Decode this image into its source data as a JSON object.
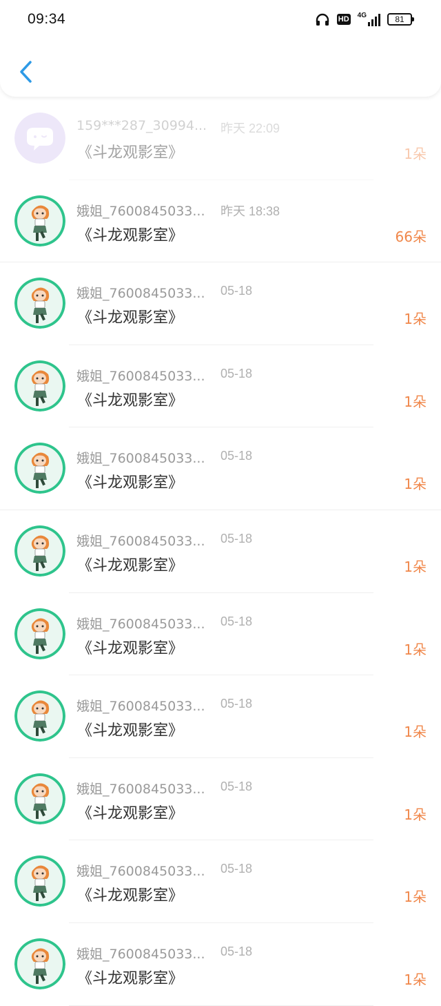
{
  "status_bar": {
    "time": "09:34",
    "icons": [
      "headphones-icon",
      "hd-icon",
      "cellular-4g-icon",
      "battery-icon"
    ],
    "hd_label": "HD",
    "network_label": "4G",
    "battery_level": "81"
  },
  "header": {
    "back_icon": "chevron-left-icon",
    "accent_color": "#2e9ae6"
  },
  "colors": {
    "flower_count": "#f0874a",
    "username": "#9a9a9a",
    "time": "#b0b0b0",
    "title": "#333333"
  },
  "records": [
    {
      "user": "159***287_30994...",
      "time": "昨天 22:09",
      "title": "《斗龙观影室》",
      "count": "1朵",
      "avatar": "chat-bubble-avatar"
    },
    {
      "user": "娥姐_7600845033...",
      "time": "昨天 18:38",
      "title": "《斗龙观影室》",
      "count": "66朵",
      "avatar": "anime-girl-avatar"
    },
    {
      "user": "娥姐_7600845033...",
      "time": "05-18",
      "title": "《斗龙观影室》",
      "count": "1朵",
      "avatar": "anime-girl-avatar"
    },
    {
      "user": "娥姐_7600845033...",
      "time": "05-18",
      "title": "《斗龙观影室》",
      "count": "1朵",
      "avatar": "anime-girl-avatar"
    },
    {
      "user": "娥姐_7600845033...",
      "time": "05-18",
      "title": "《斗龙观影室》",
      "count": "1朵",
      "avatar": "anime-girl-avatar"
    },
    {
      "user": "娥姐_7600845033...",
      "time": "05-18",
      "title": "《斗龙观影室》",
      "count": "1朵",
      "avatar": "anime-girl-avatar"
    },
    {
      "user": "娥姐_7600845033...",
      "time": "05-18",
      "title": "《斗龙观影室》",
      "count": "1朵",
      "avatar": "anime-girl-avatar"
    },
    {
      "user": "娥姐_7600845033...",
      "time": "05-18",
      "title": "《斗龙观影室》",
      "count": "1朵",
      "avatar": "anime-girl-avatar"
    },
    {
      "user": "娥姐_7600845033...",
      "time": "05-18",
      "title": "《斗龙观影室》",
      "count": "1朵",
      "avatar": "anime-girl-avatar"
    },
    {
      "user": "娥姐_7600845033...",
      "time": "05-18",
      "title": "《斗龙观影室》",
      "count": "1朵",
      "avatar": "anime-girl-avatar"
    },
    {
      "user": "娥姐_7600845033...",
      "time": "05-18",
      "title": "《斗龙观影室》",
      "count": "1朵",
      "avatar": "anime-girl-avatar"
    }
  ]
}
